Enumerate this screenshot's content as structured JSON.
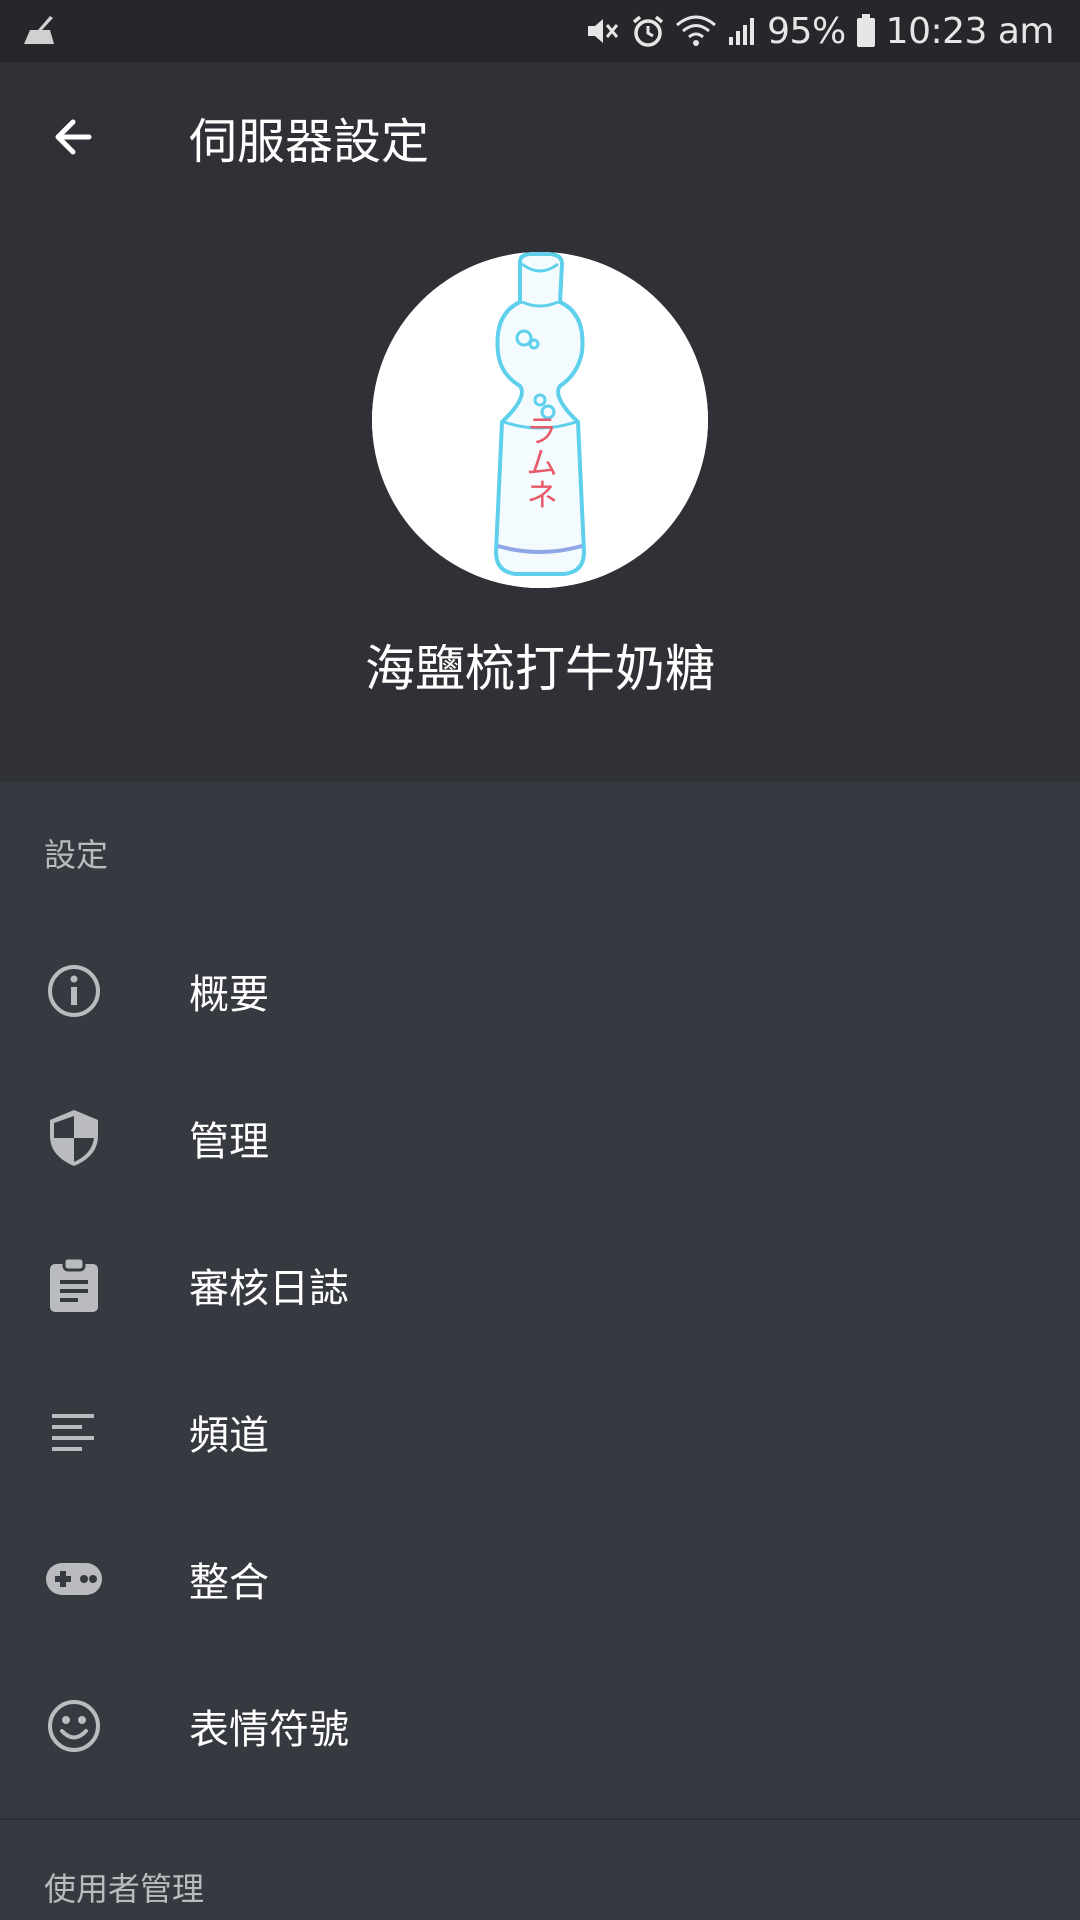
{
  "status_bar": {
    "battery": "95%",
    "time": "10:23 am",
    "icons": [
      "cleaner-icon",
      "mute-icon",
      "alarm-icon",
      "wifi-icon",
      "signal-icon",
      "battery-icon"
    ]
  },
  "app_bar": {
    "title": "伺服器設定",
    "back_icon": "arrow-back-icon"
  },
  "server": {
    "name": "海鹽梳打牛奶糖",
    "avatar_text": "ラムネ"
  },
  "sections": [
    {
      "label": "設定",
      "items": [
        {
          "label": "概要",
          "icon": "info-icon"
        },
        {
          "label": "管理",
          "icon": "shield-icon"
        },
        {
          "label": "審核日誌",
          "icon": "clipboard-icon"
        },
        {
          "label": "頻道",
          "icon": "text-lines-icon"
        },
        {
          "label": "整合",
          "icon": "gamepad-icon"
        },
        {
          "label": "表情符號",
          "icon": "smiley-icon"
        }
      ]
    },
    {
      "label": "使用者管理",
      "items": []
    }
  ],
  "colors": {
    "background": "#36393f",
    "header": "#2f3136",
    "status_bar": "#26272b",
    "icon": "#b9bbbe",
    "text": "#ffffff"
  }
}
